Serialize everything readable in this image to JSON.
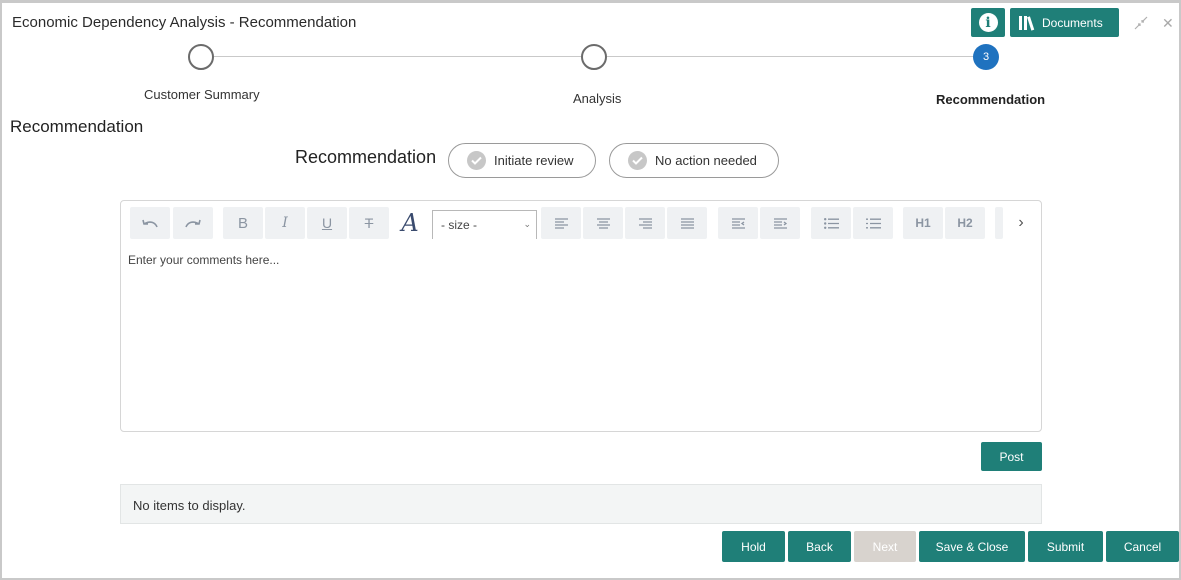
{
  "header": {
    "title": "Economic Dependency Analysis - Recommendation",
    "documents_label": "Documents"
  },
  "stepper": {
    "steps": [
      {
        "label": "Customer Summary",
        "state": "incomplete"
      },
      {
        "label": "Analysis",
        "state": "incomplete"
      },
      {
        "label": "Recommendation",
        "state": "active",
        "number": "3"
      }
    ]
  },
  "section": {
    "heading": "Recommendation"
  },
  "recommendation": {
    "label": "Recommendation",
    "options": [
      "Initiate review",
      "No action needed"
    ]
  },
  "editor": {
    "size_select": "- size -",
    "placeholder": "Enter your comments here...",
    "h1": "H1",
    "h2": "H2"
  },
  "post_label": "Post",
  "empty_message": "No items to display.",
  "footer": {
    "hold": "Hold",
    "back": "Back",
    "next": "Next",
    "save_close": "Save & Close",
    "submit": "Submit",
    "cancel": "Cancel"
  },
  "colors": {
    "primary": "#1f7f78",
    "active_step": "#1f72bf",
    "disabled": "#d8d3ce"
  }
}
